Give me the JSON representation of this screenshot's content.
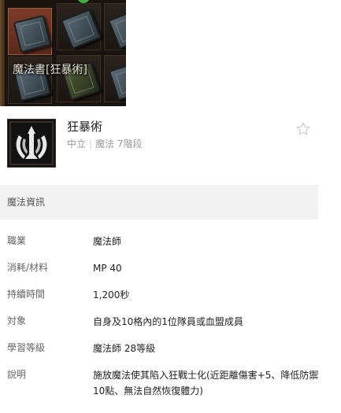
{
  "game_screenshot": {
    "item_label": "魔法書[狂暴術]"
  },
  "skill": {
    "name": "狂暴術",
    "alignment": "中立",
    "type": "魔法 7階段",
    "icon": "berserk-emblem-icon"
  },
  "favorite_icon": "star-outline-icon",
  "section": {
    "title": "魔法資訊"
  },
  "info": [
    {
      "label": "職業",
      "value": "魔法師"
    },
    {
      "label": "消耗/材料",
      "value": "MP 40"
    },
    {
      "label": "持續時間",
      "value": "1,200秒"
    },
    {
      "label": "対象",
      "value": "自身及10格內的1位隊員或血盟成員"
    },
    {
      "label": "學習等級",
      "value": "魔法師 28等級"
    },
    {
      "label": "說明",
      "value": "施放魔法使其陷入狂戰士化(近距離傷害+5、降低防禦10點、無法自然恢復體力)"
    }
  ],
  "colors": {
    "section_bg": "#f2f2f2",
    "meta_text": "#9a9a9a",
    "star_outline": "#c8c8c8"
  }
}
